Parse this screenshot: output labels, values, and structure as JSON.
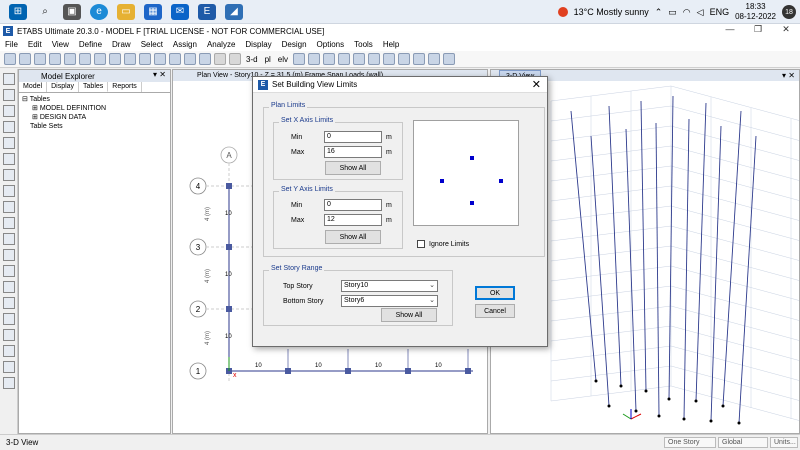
{
  "taskbar": {
    "weather": "13°C  Mostly sunny",
    "language": "ENG",
    "time": "18:33",
    "date": "08-12-2022",
    "notification_count": "18"
  },
  "window": {
    "title": "ETABS Ultimate 20.3.0 - MODEL F  [TRIAL LICENSE - NOT FOR COMMERCIAL USE]",
    "controls": [
      "—",
      "❐",
      "✕"
    ]
  },
  "menu": [
    "File",
    "Edit",
    "View",
    "Define",
    "Draw",
    "Select",
    "Assign",
    "Analyze",
    "Display",
    "Design",
    "Options",
    "Tools",
    "Help"
  ],
  "toolbar": {
    "view_3d_label": "3-d",
    "view_pl_label": "pl",
    "view_elv_label": "elv"
  },
  "explorer": {
    "title": "Model Explorer",
    "tabs": [
      "Model",
      "Display",
      "Tables",
      "Reports"
    ],
    "active_tab": "Tables",
    "tree": {
      "root": "Tables",
      "children": [
        "MODEL DEFINITION",
        "DESIGN DATA"
      ],
      "sibling": "Table Sets"
    }
  },
  "plan_view": {
    "tab_title": "Plan View - Story10 - Z = 31.5 (m)  Frame Span Loads (wall)",
    "grid_col_label": "A",
    "grid_row_labels": [
      "4",
      "3",
      "2",
      "1"
    ],
    "dim_labels": [
      "4 (m)",
      "4 (m)",
      "4 (m)"
    ],
    "span_labels": [
      "10",
      "10",
      "10",
      "10"
    ],
    "beam_loads": [
      "10",
      "10",
      "10"
    ]
  },
  "view_3d": {
    "tab_title": "3-D View"
  },
  "status": {
    "left": "3-D View",
    "story_select": "One Story",
    "coord_select": "Global",
    "units_button": "Units..."
  },
  "dialog": {
    "title": "Set Building View Limits",
    "close": "✕",
    "plan_limits_label": "Plan Limits",
    "x_group_label": "Set X Axis Limits",
    "y_group_label": "Set Y Axis Limits",
    "min_label": "Min",
    "max_label": "Max",
    "unit": "m",
    "x_min": "0",
    "x_max": "16",
    "y_min": "0",
    "y_max": "12",
    "show_all": "Show All",
    "ignore_limits": "Ignore Limits",
    "story_group_label": "Set Story Range",
    "top_story_label": "Top Story",
    "bottom_story_label": "Bottom Story",
    "top_story": "Story10",
    "bottom_story": "Story6",
    "ok": "OK",
    "cancel": "Cancel"
  },
  "colors": {
    "accent": "#0078d7",
    "group_label": "#1a3a8c",
    "grid_point": "#0000cc",
    "frame_line": "#2d3a8c"
  }
}
